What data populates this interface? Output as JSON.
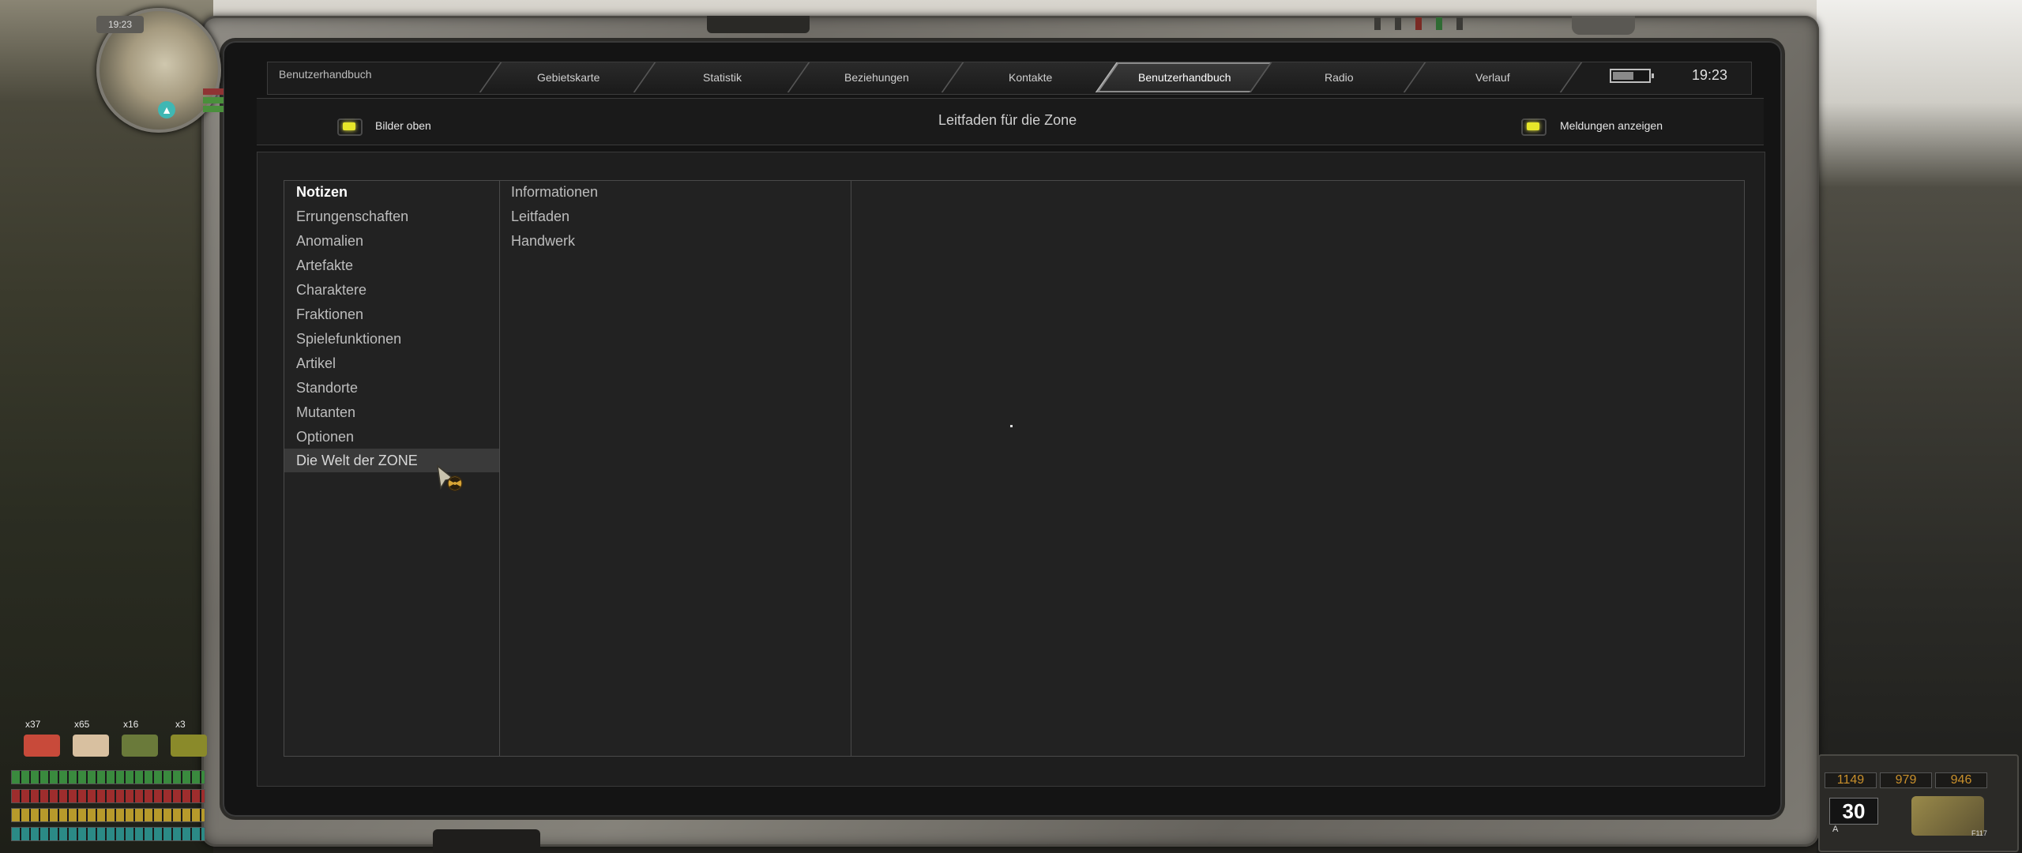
{
  "pda": {
    "title": "Benutzerhandbuch",
    "tabs": [
      {
        "label": "Gebietskarte",
        "active": false
      },
      {
        "label": "Statistik",
        "active": false
      },
      {
        "label": "Beziehungen",
        "active": false
      },
      {
        "label": "Kontakte",
        "active": false
      },
      {
        "label": "Benutzerhandbuch",
        "active": true
      },
      {
        "label": "Radio",
        "active": false
      },
      {
        "label": "Verlauf",
        "active": false
      }
    ],
    "time": "19:23",
    "battery_level": 0.6
  },
  "toolbar": {
    "left_toggle_label": "Bilder oben",
    "center_title": "Leitfaden für die Zone",
    "right_toggle_label": "Meldungen anzeigen"
  },
  "categories": [
    {
      "label": "Notizen",
      "selected": true
    },
    {
      "label": "Errungenschaften"
    },
    {
      "label": "Anomalien"
    },
    {
      "label": "Artefakte"
    },
    {
      "label": "Charaktere"
    },
    {
      "label": "Fraktionen"
    },
    {
      "label": "Spielefunktionen"
    },
    {
      "label": "Artikel"
    },
    {
      "label": "Standorte"
    },
    {
      "label": "Mutanten"
    },
    {
      "label": "Optionen"
    },
    {
      "label": "Die Welt der ZONE",
      "hovered": true
    }
  ],
  "subcategories": [
    "Informationen",
    "Leitfaden",
    "Handwerk"
  ],
  "hud": {
    "minimap_time": "19:23",
    "quick_items": [
      {
        "count": "x37",
        "icon": "medkit-icon",
        "color": "#c84a3a"
      },
      {
        "count": "x65",
        "icon": "bandage-icon",
        "color": "#d8c0a0"
      },
      {
        "count": "x16",
        "icon": "grenade-icon",
        "color": "#6a7a3a"
      },
      {
        "count": "x3",
        "icon": "ammo-box-icon",
        "color": "#8a8a2a"
      }
    ],
    "ammo_counts": [
      "1149",
      "979",
      "946"
    ],
    "ammo_current": "30",
    "fire_mode": "A",
    "weapon_label": "F117"
  }
}
